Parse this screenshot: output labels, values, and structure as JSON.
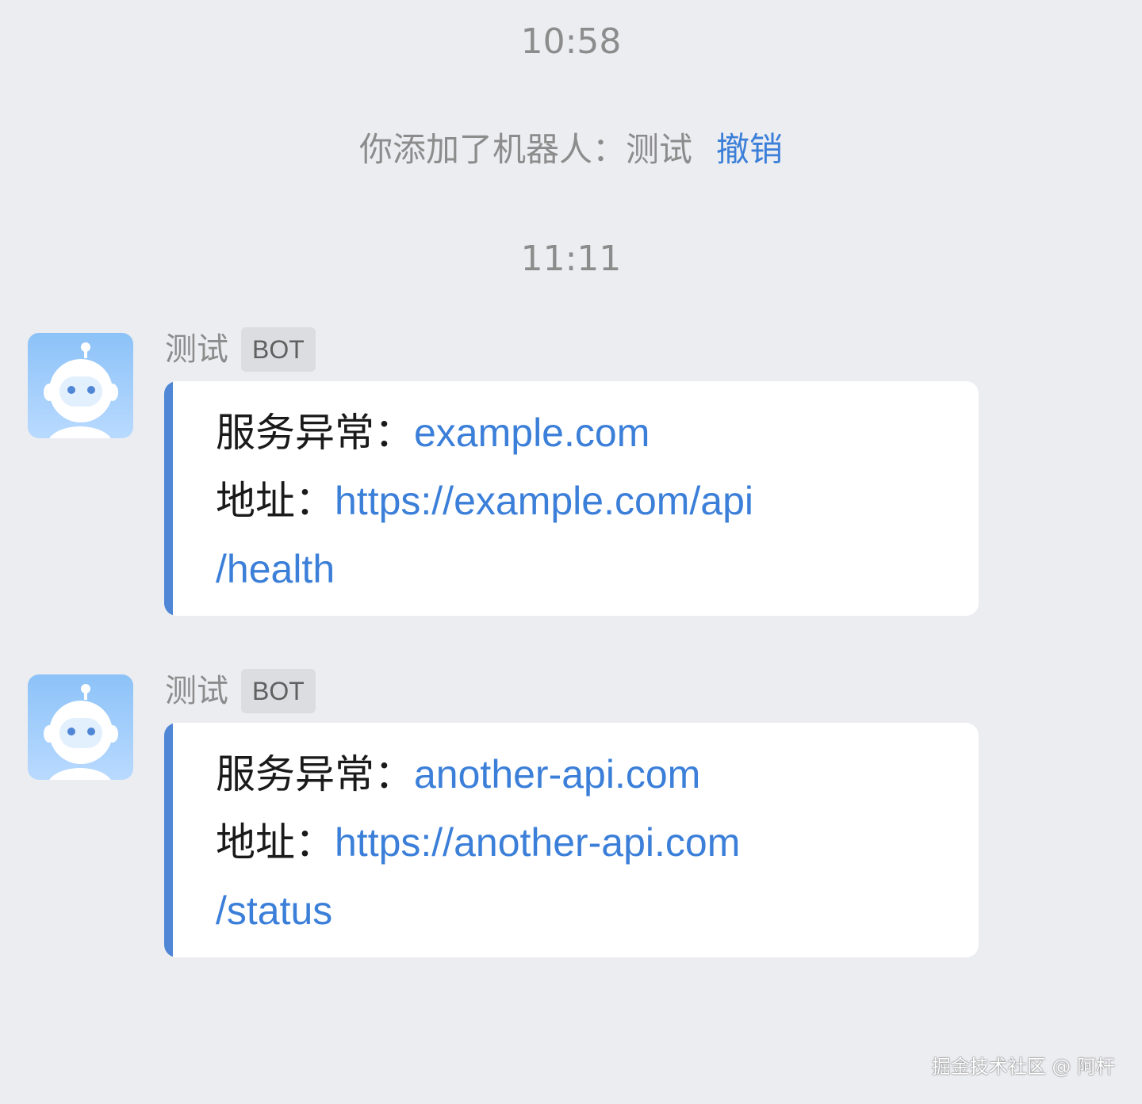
{
  "timestamps": {
    "first": "10:58",
    "second": "11:11"
  },
  "system_notice": {
    "text": "你添加了机器人：测试",
    "undo_label": "撤销"
  },
  "messages": [
    {
      "sender": "测试",
      "badge": "BOT",
      "line1_label": "服务异常：",
      "line1_value": "example.com",
      "line2_label": "地址：",
      "line2_url_part1": "https://example.com/api",
      "line2_url_part2": "/health"
    },
    {
      "sender": "测试",
      "badge": "BOT",
      "line1_label": "服务异常：",
      "line1_value": "another-api.com",
      "line2_label": "地址：",
      "line2_url_part1": "https://another-api.com",
      "line2_url_part2": "/status"
    }
  ],
  "watermark": "掘金技术社区 @ 阿杆",
  "colors": {
    "background": "#ecedf1",
    "link": "#3b7fd9",
    "card_accent_bar": "#4f86d6",
    "muted_text": "#8c8c8c"
  },
  "icons": {
    "avatar": "robot-avatar-icon"
  }
}
